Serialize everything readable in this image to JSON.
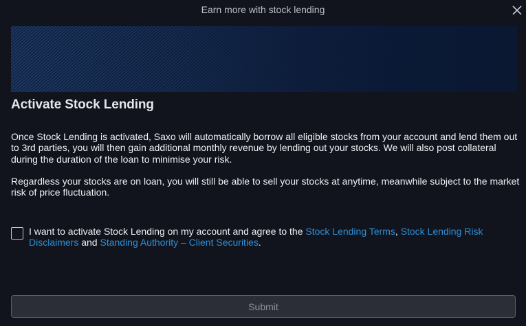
{
  "dialog": {
    "title": "Earn more with stock lending"
  },
  "content": {
    "heading": "Activate Stock Lending",
    "paragraph1": "Once Stock Lending is activated, Saxo will automatically borrow all eligible stocks from your account and lend them out to 3rd parties, you will then gain additional monthly revenue by lending out your stocks. We will also post collateral during the duration of the loan to minimise your risk.",
    "paragraph2": "Regardless your stocks are on loan, you will still be able to sell your stocks at anytime, meanwhile subject to the market risk of price fluctuation."
  },
  "agreement": {
    "checked": false,
    "text_before": "I want to activate Stock Lending on my account and agree to the ",
    "link1": "Stock Lending Terms",
    "separator": ", ",
    "link2": "Stock Lending Risk Disclaimers",
    "conjunction": " and ",
    "link3": "Standing Authority – Client Securities",
    "text_after": "."
  },
  "actions": {
    "submit_label": "Submit"
  },
  "icons": {
    "close": "close-icon",
    "checkbox": "checkbox-icon"
  },
  "colors": {
    "background": "#11141c",
    "banner": "#0b1a37",
    "link": "#2f8fd8",
    "submit_bg": "#2b2e37"
  }
}
